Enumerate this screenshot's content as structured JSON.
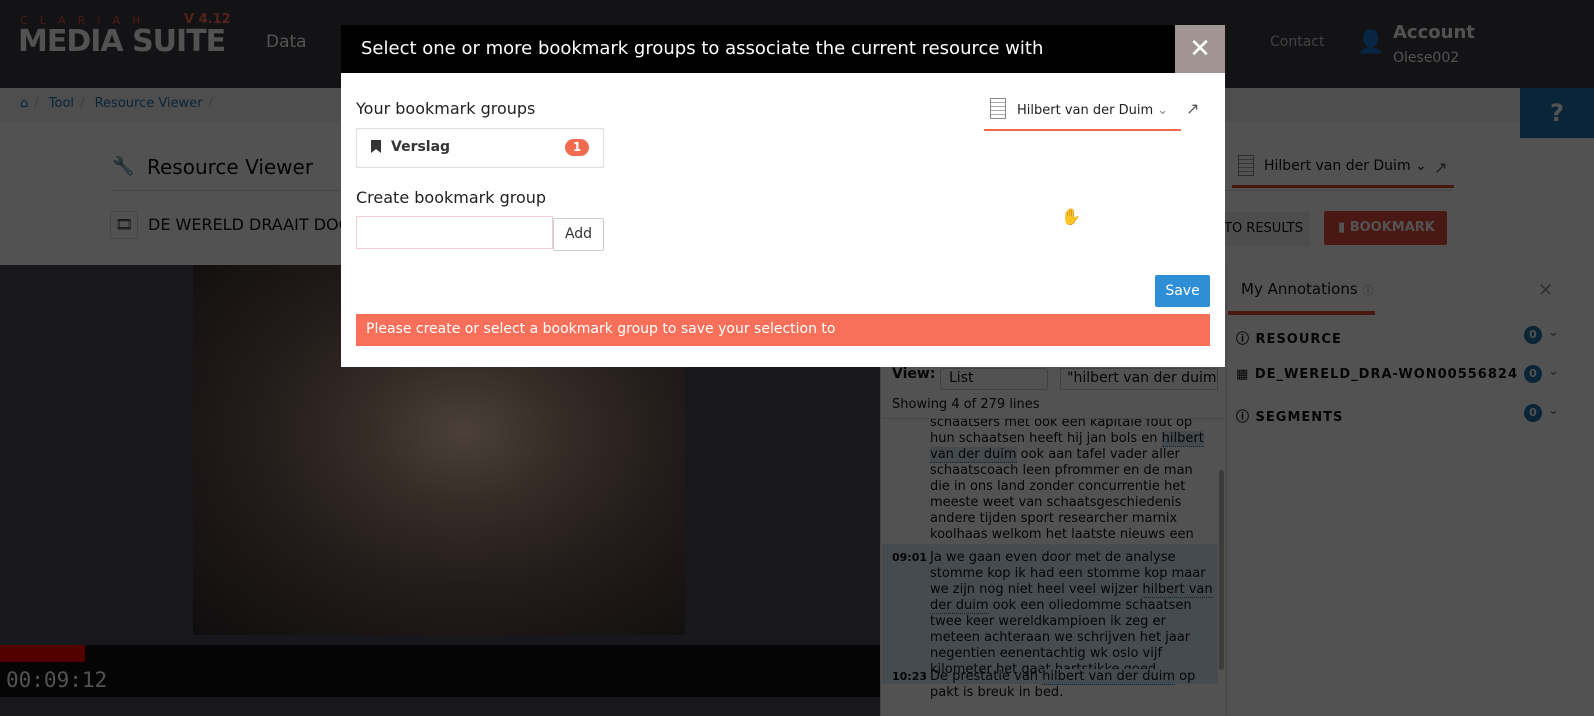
{
  "header": {
    "logo_top": "CLARIAH",
    "logo_main": "MEDIA SUITE",
    "version": "V 4.12",
    "nav": [
      "Data",
      "Contact"
    ],
    "account_label": "Account",
    "account_user": "Olese002",
    "help": "?"
  },
  "breadcrumb": [
    "Tool",
    "Resource Viewer"
  ],
  "page": {
    "title": "Resource Viewer",
    "resource_title": "DE WERELD DRAAIT DOOR",
    "back_button": "TO RESULTS",
    "bookmark_button": "BOOKMARK",
    "collection_select": "Hilbert van der Duim"
  },
  "player": {
    "time": "00:09:12",
    "progress_percent": 9.7
  },
  "transcript": {
    "view_label": "View:",
    "view_value": "List",
    "search_value": "\"hilbert van der duim\"",
    "count": "Showing 4 of 279 lines",
    "lines": [
      {
        "time": "",
        "pre": "schaatsers met ook een kapitale fout op hun schaatsen heeft hij jan bols en ",
        "hl": "hilbert van der duim",
        "post": " ook aan tafel vader aller schaatscoach leen pfrommer en de man die in ons land zonder concurrentie het meeste weet van schaatsgeschiedenis andere tijden sport researcher marnix koolhaas welkom het laatste nieuws een half uur geleden op de."
      },
      {
        "time": "09:01",
        "pre": "Ja we gaan even door met de analyse stomme kop ik had een stomme kop maar we zijn nog niet heel veel wijzer ",
        "hl": "hilbert van der duim",
        "post": " ook een oliedomme schaatsen twee keer wereldkampioen ik zeg er meteen achteraan we schrijven het jaar negentien eenentachtig wk oslo vijf kilometer het gaat hartstikke goed."
      },
      {
        "time": "10:23",
        "pre": "De prestatie van ",
        "hl": "hilbert van der duim",
        "post": " op pakt is breuk in bed."
      }
    ]
  },
  "annotations": {
    "tab": "My Annotations",
    "rows": [
      {
        "label": "RESOURCE",
        "count": "0"
      },
      {
        "label": "DE_WERELD_DRA-WON00556824",
        "count": "0"
      },
      {
        "label": "SEGMENTS",
        "count": "0"
      }
    ]
  },
  "modal": {
    "title": "Select one or more bookmark groups to associate the current resource with",
    "close": "✕",
    "groups_label": "Your bookmark groups",
    "groups": [
      {
        "name": "Verslag",
        "count": "1"
      }
    ],
    "create_label": "Create bookmark group",
    "create_value": "",
    "add_button": "Add",
    "save_button": "Save",
    "error": "Please create or select a bookmark group to save your selection to",
    "collection_select": "Hilbert van der Duim"
  },
  "colors": {
    "accent": "#e74c3c",
    "primary": "#2f8fd6",
    "error": "#f8705a"
  }
}
